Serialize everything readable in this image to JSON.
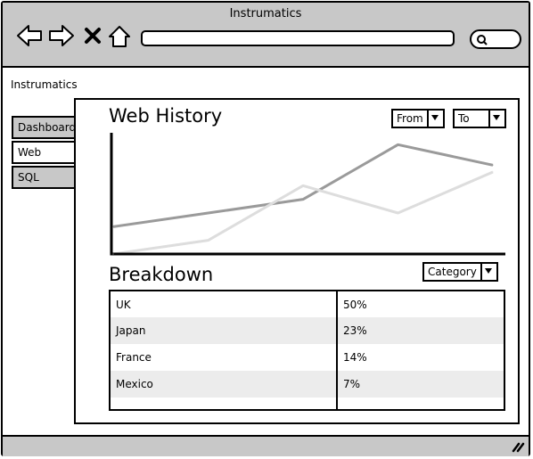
{
  "window": {
    "title": "Instrumatics"
  },
  "browser": {
    "icons": [
      "back-arrow-icon",
      "forward-arrow-icon",
      "close-icon",
      "home-icon",
      "search-icon"
    ],
    "url_value": ""
  },
  "app": {
    "label": "Instrumatics"
  },
  "tabs": [
    {
      "label": "Dashboard",
      "active": false
    },
    {
      "label": "Web",
      "active": true
    },
    {
      "label": "SQL",
      "active": false
    }
  ],
  "web_history": {
    "title": "Web History",
    "from_label": "From",
    "to_label": "To"
  },
  "chart_data": {
    "type": "line",
    "title": "",
    "xlabel": "",
    "ylabel": "",
    "x": [
      0,
      1,
      2,
      3,
      4
    ],
    "series": [
      {
        "values": [
          3,
          4,
          8,
          6,
          9
        ],
        "color": "#dddddd"
      },
      {
        "values": [
          5,
          6,
          7,
          11,
          9.5
        ],
        "color": "#9a9a9a"
      }
    ],
    "ylim": [
      3,
      12
    ],
    "grid": false
  },
  "breakdown": {
    "title": "Breakdown",
    "category_label": "Category",
    "rows": [
      {
        "country": "UK",
        "percent": "50%"
      },
      {
        "country": "Japan",
        "percent": "23%"
      },
      {
        "country": "France",
        "percent": "14%"
      },
      {
        "country": "Mexico",
        "percent": "7%"
      }
    ]
  },
  "colors": {
    "chrome": "#c8c8c8",
    "row_alt": "#ececec"
  }
}
